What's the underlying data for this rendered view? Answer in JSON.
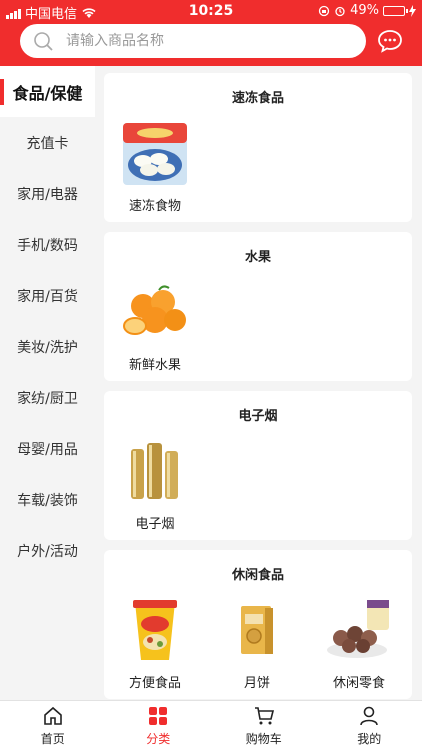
{
  "status": {
    "carrier": "中国电信",
    "time": "10:25",
    "battery": "49%",
    "battery_level": 0.49
  },
  "search": {
    "placeholder": "请输入商品名称"
  },
  "sidebar": {
    "items": [
      {
        "label": "食品/保健"
      },
      {
        "label": "充值卡"
      },
      {
        "label": "家用/电器"
      },
      {
        "label": "手机/数码"
      },
      {
        "label": "家用/百货"
      },
      {
        "label": "美妆/洗护"
      },
      {
        "label": "家纺/厨卫"
      },
      {
        "label": "母婴/用品"
      },
      {
        "label": "车载/装饰"
      },
      {
        "label": "户外/活动"
      }
    ]
  },
  "sections": [
    {
      "title": "速冻食品",
      "items": [
        {
          "label": "速冻食物",
          "icon": "dumplings-image"
        }
      ]
    },
    {
      "title": "水果",
      "items": [
        {
          "label": "新鲜水果",
          "icon": "oranges-image"
        }
      ]
    },
    {
      "title": "电子烟",
      "items": [
        {
          "label": "电子烟",
          "icon": "ecig-image"
        }
      ]
    },
    {
      "title": "休闲食品",
      "items": [
        {
          "label": "方便食品",
          "icon": "noodle-cup-image"
        },
        {
          "label": "月饼",
          "icon": "mooncake-box-image"
        },
        {
          "label": "休闲零食",
          "icon": "dried-plums-image"
        }
      ]
    }
  ],
  "tabs": [
    {
      "label": "首页"
    },
    {
      "label": "分类"
    },
    {
      "label": "购物车"
    },
    {
      "label": "我的"
    }
  ],
  "colors": {
    "accent": "#f02d2d",
    "background": "#f4f4f4"
  }
}
